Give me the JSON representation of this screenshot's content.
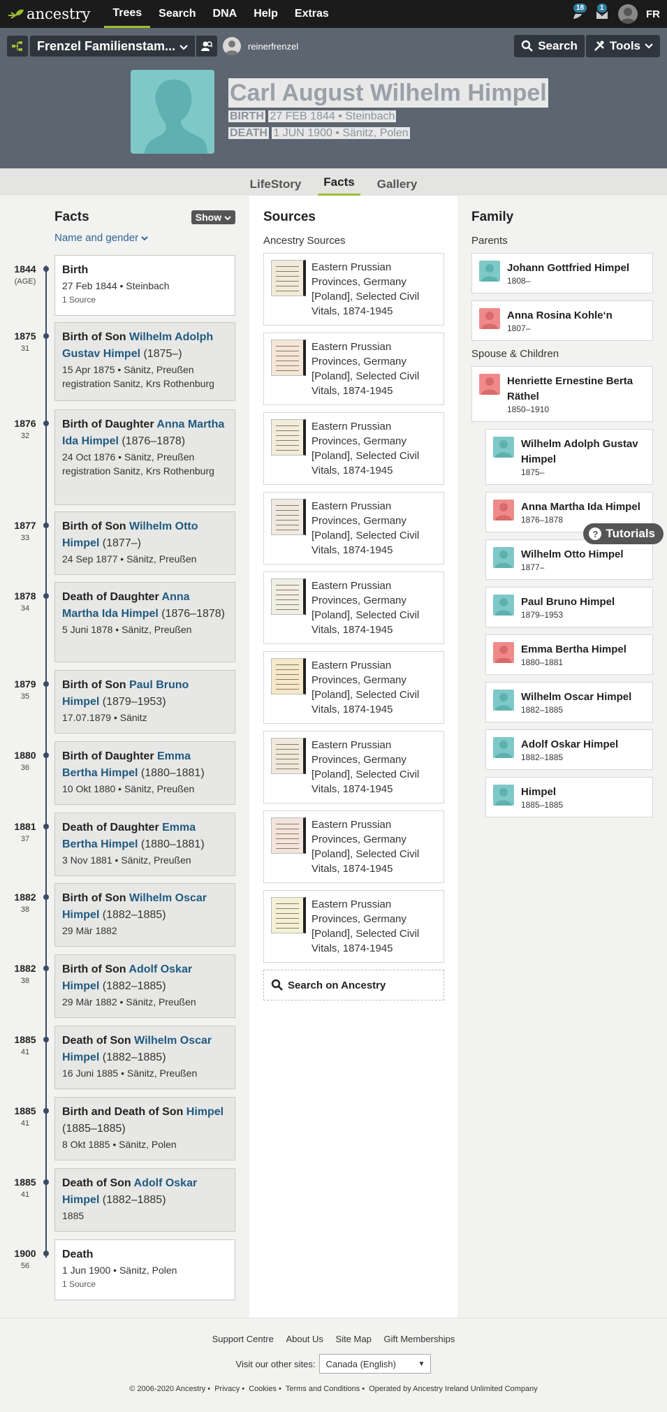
{
  "nav": {
    "brand": "ancestry",
    "links": [
      "Trees",
      "Search",
      "DNA",
      "Help",
      "Extras"
    ],
    "notif_count_1": "18",
    "notif_count_2": "1",
    "lang": "FR"
  },
  "treebar": {
    "tree_name": "Frenzel Familienstam...",
    "username": "reinerfrenzel",
    "search_label": "Search",
    "tools_label": "Tools"
  },
  "person": {
    "name": "Carl August Wilhelm Himpel",
    "birth_label": "BIRTH",
    "birth_value": "27 FEB 1844 • Steinbach",
    "death_label": "DEATH",
    "death_value": "1 JUN 1900 • Sänitz, Polen"
  },
  "tabs": [
    "LifeStory",
    "Facts",
    "Gallery"
  ],
  "facts": {
    "title": "Facts",
    "show_label": "Show",
    "filter_label": "Name and gender",
    "items": [
      {
        "year": "1844",
        "age": "(AGE)",
        "title": "Birth",
        "meta": "27 Feb 1844 • Steinbach",
        "src": "1 Source"
      },
      {
        "year": "1875",
        "age": "31",
        "pre": "Birth of Son ",
        "person": "Wilhelm Adolph Gustav Himpel",
        "dates": " (1875–)",
        "meta": "15 Apr 1875 • Sänitz, Preußen registration Sanitz, Krs Rothenburg"
      },
      {
        "year": "1876",
        "age": "32",
        "pre": "Birth of Daughter ",
        "person": "Anna Martha Ida Himpel",
        "dates": " (1876–1878)",
        "meta": "24 Oct 1876 • Sänitz, Preußen registration Sanitz, Krs Rothenburg"
      },
      {
        "year": "1877",
        "age": "33",
        "pre": "Birth of Son ",
        "person": "Wilhelm Otto Himpel",
        "dates": " (1877–)",
        "meta": "24 Sep 1877 • Sänitz, Preußen"
      },
      {
        "year": "1878",
        "age": "34",
        "pre": "Death of Daughter ",
        "person": "Anna Martha Ida Himpel",
        "dates": " (1876–1878)",
        "meta": "5 Juni 1878 • Sänitz, Preußen"
      },
      {
        "year": "1879",
        "age": "35",
        "pre": "Birth of Son ",
        "person": "Paul Bruno Himpel",
        "dates": " (1879–1953)",
        "meta": "17.07.1879 • Sänitz"
      },
      {
        "year": "1880",
        "age": "36",
        "pre": "Birth of Daughter ",
        "person": "Emma Bertha Himpel",
        "dates": " (1880–1881)",
        "meta": "10 Okt 1880 • Sänitz, Preußen"
      },
      {
        "year": "1881",
        "age": "37",
        "pre": "Death of Daughter ",
        "person": "Emma Bertha Himpel",
        "dates": " (1880–1881)",
        "meta": "3 Nov 1881 • Sänitz, Preußen"
      },
      {
        "year": "1882",
        "age": "38",
        "pre": "Birth of Son ",
        "person": "Wilhelm Oscar Himpel",
        "dates": " (1882–1885)",
        "meta": "29 Mär 1882"
      },
      {
        "year": "1882",
        "age": "38",
        "pre": "Birth of Son ",
        "person": "Adolf Oskar Himpel",
        "dates": " (1882–1885)",
        "meta": "29 Mär 1882 • Sänitz, Preußen"
      },
      {
        "year": "1885",
        "age": "41",
        "pre": "Death of Son ",
        "person": "Wilhelm Oscar Himpel",
        "dates": " (1882–1885)",
        "meta": "16 Juni 1885 • Sänitz, Preußen"
      },
      {
        "year": "1885",
        "age": "41",
        "pre": "Birth and Death of Son ",
        "person": "Himpel",
        "dates": " (1885–1885)",
        "meta": "8 Okt 1885 • Sänitz, Polen"
      },
      {
        "year": "1885",
        "age": "41",
        "pre": "Death of Son ",
        "person": "Adolf Oskar Himpel",
        "dates": " (1882–1885)",
        "meta": "1885"
      },
      {
        "year": "1900",
        "age": "56",
        "title": "Death",
        "meta": "1 Jun 1900 • Sänitz, Polen",
        "src": "1 Source"
      }
    ]
  },
  "sources": {
    "title": "Sources",
    "subtitle": "Ancestry Sources",
    "item_label": "Eastern Prussian Provinces, Germany [Poland], Selected Civil Vitals, 1874-1945",
    "search_label": "Search on Ancestry"
  },
  "family": {
    "title": "Family",
    "parents_label": "Parents",
    "parents": [
      {
        "name": "Johann Gottfried Himpel",
        "dates": "1808–",
        "gender": "m"
      },
      {
        "name": "Anna Rosina Kohle‘n",
        "dates": "1807–",
        "gender": "f"
      }
    ],
    "spouse_label": "Spouse & Children",
    "spouse": {
      "name": "Henriette Ernestine Berta Räthel",
      "dates": "1850–1910",
      "gender": "f"
    },
    "children": [
      {
        "name": "Wilhelm Adolph Gustav Himpel",
        "dates": "1875–",
        "gender": "m"
      },
      {
        "name": "Anna Martha Ida Himpel",
        "dates": "1876–1878",
        "gender": "f"
      },
      {
        "name": "Wilhelm Otto Himpel",
        "dates": "1877–",
        "gender": "m"
      },
      {
        "name": "Paul Bruno Himpel",
        "dates": "1879–1953",
        "gender": "m"
      },
      {
        "name": "Emma Bertha Himpel",
        "dates": "1880–1881",
        "gender": "f"
      },
      {
        "name": "Wilhelm Oscar Himpel",
        "dates": "1882–1885",
        "gender": "m"
      },
      {
        "name": "Adolf Oskar Himpel",
        "dates": "1882–1885",
        "gender": "m"
      },
      {
        "name": "Himpel",
        "dates": "1885–1885",
        "gender": "m"
      }
    ]
  },
  "tutorials_label": "Tutorials",
  "footer": {
    "links": [
      "Support Centre",
      "About Us",
      "Site Map",
      "Gift Memberships"
    ],
    "other_sites_label": "Visit our other sites:",
    "site_select": "Canada (English)",
    "copyright": [
      "© 2006-2020 Ancestry",
      "Privacy",
      "Cookies",
      "Terms and Conditions",
      "Operated by Ancestry Ireland Unlimited Company"
    ]
  },
  "colors": {
    "accent": "#9cbe30",
    "link": "#1f5a80",
    "male": "#7fc8c8",
    "female": "#f08a8a",
    "header": "#5d6570"
  }
}
